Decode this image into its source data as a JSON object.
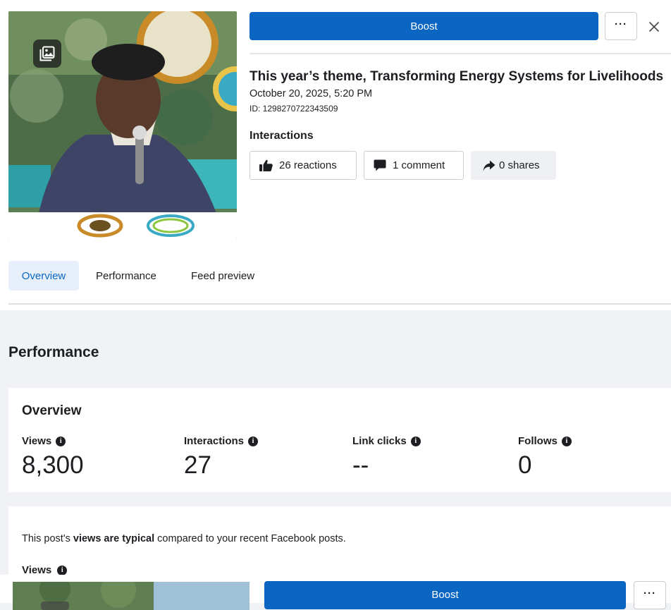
{
  "post": {
    "boost_label": "Boost",
    "more_label": "···",
    "title": "This year’s theme, Transforming Energy Systems for Livelihoods",
    "date": "October 20, 2025, 5:20 PM",
    "id_text": "ID: 1298270722343509"
  },
  "interactions": {
    "heading": "Interactions",
    "reactions": "26 reactions",
    "comments": "1 comment",
    "shares": "0 shares"
  },
  "tabs": [
    {
      "label": "Overview",
      "active": true
    },
    {
      "label": "Performance",
      "active": false
    },
    {
      "label": "Feed preview",
      "active": false
    }
  ],
  "performance": {
    "heading": "Performance",
    "overview_title": "Overview",
    "metrics": [
      {
        "label": "Views",
        "value": "8,300"
      },
      {
        "label": "Interactions",
        "value": "27"
      },
      {
        "label": "Link clicks",
        "value": "--"
      },
      {
        "label": "Follows",
        "value": "0"
      }
    ],
    "typical_pre": "This post's ",
    "typical_bold": "views are typical",
    "typical_post": " compared to your recent Facebook posts.",
    "views_sub": "Views"
  },
  "colors": {
    "accent": "#0a66c2",
    "tab_active_bg": "#e7f0fa",
    "page_bg": "#f0f2f5"
  },
  "icons": {
    "image_badge": "image-icon",
    "close": "close-icon",
    "reactions": "thumbs-up-icon",
    "comments": "comment-icon",
    "shares": "share-icon",
    "info": "info-icon"
  }
}
